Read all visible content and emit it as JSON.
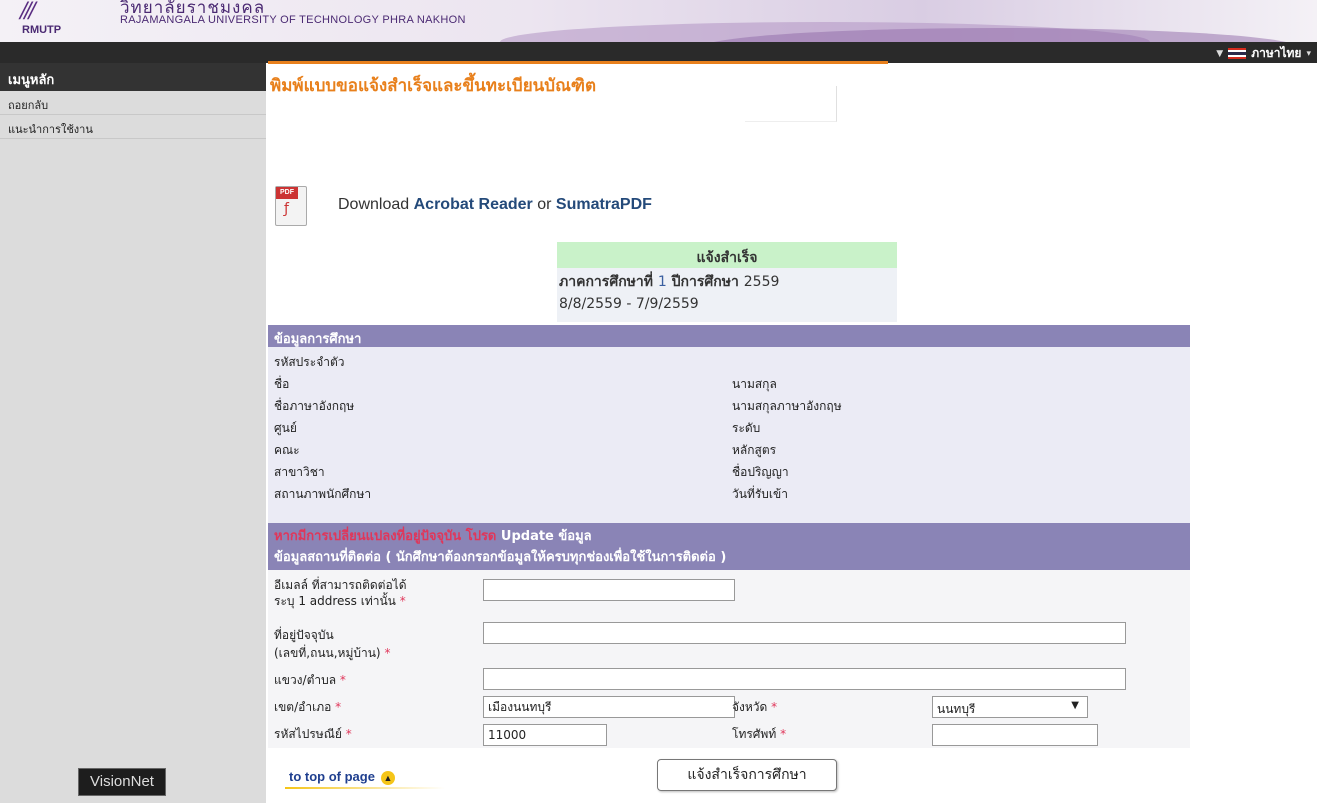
{
  "header": {
    "logo_abbr": "RMUTP",
    "univ_thai": "วิทยาลัยราชมงคล",
    "univ_en": "RAJAMANGALA UNIVERSITY  OF TECHNOLOGY PHRA NAKHON"
  },
  "topbar": {
    "language": "ภาษาไทย"
  },
  "sidebar": {
    "heading": "เมนูหลัก",
    "items": [
      {
        "label": "ถอยกลับ"
      },
      {
        "label": "แนะนำการใช้งาน"
      }
    ],
    "footer_logo": "VisionNet"
  },
  "page": {
    "title": "พิมพ์แบบขอแจ้งสำเร็จและขึ้นทะเบียนบัณฑิต",
    "download": {
      "prefix": "Download ",
      "link1": "Acrobat Reader",
      "or": " or ",
      "link2": "SumatraPDF"
    }
  },
  "notice": {
    "heading": "แจ้งสำเร็จ",
    "term_label": "ภาคการศึกษาที่",
    "term_value": "1",
    "year_label": "ปีการศึกษา",
    "year_value": "2559",
    "dates": "8/8/2559 - 7/9/2559"
  },
  "education": {
    "heading": "ข้อมูลการศึกษา",
    "left_labels": [
      "รหัสประจำตัว",
      "ชื่อ",
      "ชื่อภาษาอังกฤษ",
      "ศูนย์",
      "คณะ",
      "สาขาวิชา",
      "สถานภาพนักศึกษา"
    ],
    "right_labels": [
      "นามสกุล",
      "นามสกุลภาษาอังกฤษ",
      "ระดับ",
      "หลักสูตร",
      "ชื่อปริญญา",
      "วันที่รับเข้า"
    ]
  },
  "contact": {
    "update_notice_prefix": "หากมีการเปลี่ยนแปลงที่อยู่ปัจจุบัน โปรด ",
    "update_notice_link": "Update ข้อมูล",
    "heading": "ข้อมูลสถานที่ติดต่อ ( นักศึกษาต้องกรอกข้อมูลให้ครบทุกช่องเพื่อใช้ในการติดต่อ )",
    "email_label_1": "อีเมลล์ ที่สามารถติดต่อได้",
    "email_label_2": "ระบุ 1 address เท่านั้น",
    "email_value": "",
    "address_label_1": "ที่อยู่ปัจจุบัน",
    "address_label_2": "(เลขที่,ถนน,หมู่บ้าน)",
    "address_value": "",
    "subdistrict_label": "แขวง/ตำบล",
    "subdistrict_value": "",
    "district_label": "เขต/อำเภอ",
    "district_value": "เมืองนนทบุรี",
    "province_label": "จังหวัด",
    "province_value": "นนทบุรี",
    "postal_label": "รหัสไปรษณีย์",
    "postal_value": "11000",
    "phone_label": "โทรศัพท์",
    "phone_value": "",
    "required_mark": "*"
  },
  "footer": {
    "to_top": "to top of page",
    "submit": "แจ้งสำเร็จการศึกษา"
  },
  "colors": {
    "accent": "#e8801c",
    "section_bar": "#8a84b6",
    "required": "#e0365a",
    "link": "#244a7a"
  }
}
